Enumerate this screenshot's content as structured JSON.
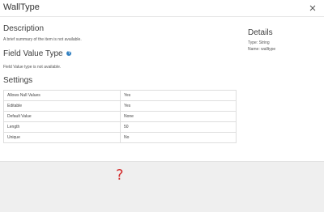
{
  "dialog": {
    "title": "WallType",
    "close_label": "×"
  },
  "description": {
    "heading": "Description",
    "text": "A brief summary of the item is not available."
  },
  "field_value_type": {
    "heading": "Field Value Type",
    "info_icon": "?",
    "text": "Field Value type is not available."
  },
  "settings": {
    "heading": "Settings",
    "rows": [
      {
        "label": "Allows Null Values",
        "value": "Yes"
      },
      {
        "label": "Editable",
        "value": "Yes"
      },
      {
        "label": "Default Value",
        "value": "None"
      },
      {
        "label": "Length",
        "value": "50"
      },
      {
        "label": "Unique",
        "value": "No"
      }
    ]
  },
  "details": {
    "heading": "Details",
    "type_line": "Type: String",
    "name_line": "Name: walltype"
  },
  "overlay": {
    "question_mark": "?",
    "question_color": "#d32f2f"
  }
}
